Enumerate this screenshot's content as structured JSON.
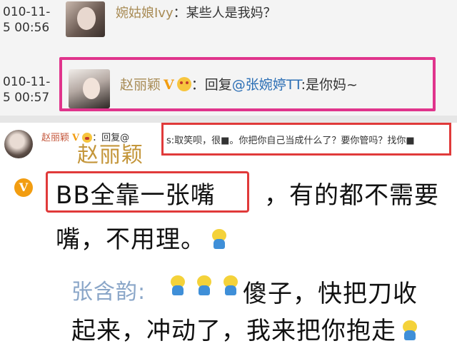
{
  "weibo_top": {
    "row1": {
      "timestamp_line1": "010-11-",
      "timestamp_line2": "5 00:56",
      "username": "婉姑娘Ivy",
      "text": "：某些人是我妈？"
    },
    "row2": {
      "timestamp_line1": "010-11-",
      "timestamp_line2": "5 00:57",
      "username": "赵丽颖",
      "verified": "V",
      "reply_prefix": "：回复",
      "mention": "@张婉婷TT",
      "text": ":是你妈",
      "tail": "~"
    }
  },
  "weibo_bottom": {
    "repost_line": {
      "username": "赵丽颖",
      "verified": "V",
      "reply_prefix": "：回复",
      "mention": "@",
      "boxed_text": "s:取笑呗，很■。你把你自己当成什么了？要你管吗？找你■"
    },
    "comment": {
      "username": "赵丽颖",
      "badge": "V",
      "highlight": "BB全靠一张嘴",
      "rest_line1": "，有的都不需要",
      "line2": "嘴，不用理。"
    },
    "reply": {
      "username": "张含韵:",
      "text_line1": "傻子，快把刀收",
      "text_line2": "起来，冲动了，我来把你抱走"
    }
  },
  "colors": {
    "pink_highlight": "#e0348c",
    "red_highlight": "#e03a3a",
    "username_gold": "#c4963a",
    "mention_blue": "#2c6fb5",
    "verified_orange": "#f29d11"
  }
}
